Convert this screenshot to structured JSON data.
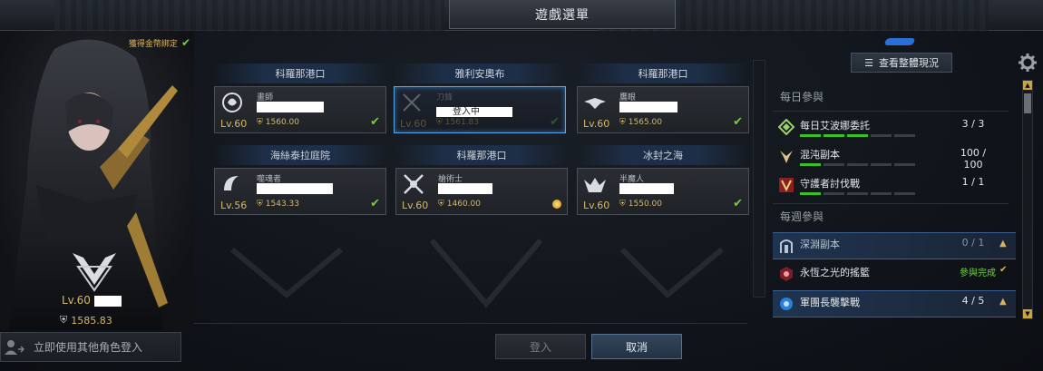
{
  "window": {
    "title": "遊戲選單"
  },
  "left": {
    "bound_label": "獲得金幣綁定",
    "level": "Lv.60",
    "power": "1585.83",
    "other_login": "立即使用其他角色登入"
  },
  "slots": [
    {
      "server": "科羅那港口",
      "class": "畫師",
      "level": "Lv.60",
      "power": "1560.00",
      "status": "check"
    },
    {
      "server": "雅利安奧布",
      "class": "刀鋒",
      "level": "Lv.60",
      "power": "1561.83",
      "status": "check",
      "overlay": "登入中"
    },
    {
      "server": "科羅那港口",
      "class": "鷹眼",
      "level": "Lv.60",
      "power": "1565.00",
      "status": "check"
    },
    {
      "server": "海絲泰拉庭院",
      "class": "噬魂者",
      "level": "Lv.56",
      "power": "1543.33",
      "status": "check"
    },
    {
      "server": "科羅那港口",
      "class": "槍術士",
      "level": "Lv.60",
      "power": "1460.00",
      "status": "coin"
    },
    {
      "server": "冰封之海",
      "class": "半魔人",
      "level": "Lv.60",
      "power": "1550.00",
      "status": "check"
    }
  ],
  "buttons": {
    "login": "登入",
    "cancel": "取消"
  },
  "right": {
    "overview_label": "查看整體現況",
    "daily_title": "每日參與",
    "weekly_title": "每週參與",
    "daily": [
      {
        "name": "每日艾波娜委託",
        "count": "3  /  3",
        "bars_on": 3,
        "bars": 5
      },
      {
        "name": "混沌副本",
        "count": "100 / 100",
        "bars_on": 1,
        "bars": 5
      },
      {
        "name": "守護者討伐戰",
        "count": "1  /  1",
        "bars_on": 1,
        "bars": 5
      }
    ],
    "weekly": [
      {
        "name": "深淵副本",
        "count": "0  /  1"
      },
      {
        "name": "永恆之光的搖籃",
        "done": "參與完成"
      },
      {
        "name": "軍團長襲擊戰",
        "count": "4  /  5"
      }
    ]
  },
  "colors": {
    "accent_blue": "#5aa6e6",
    "gold": "#d4b86a",
    "green": "#3dbf2a"
  }
}
